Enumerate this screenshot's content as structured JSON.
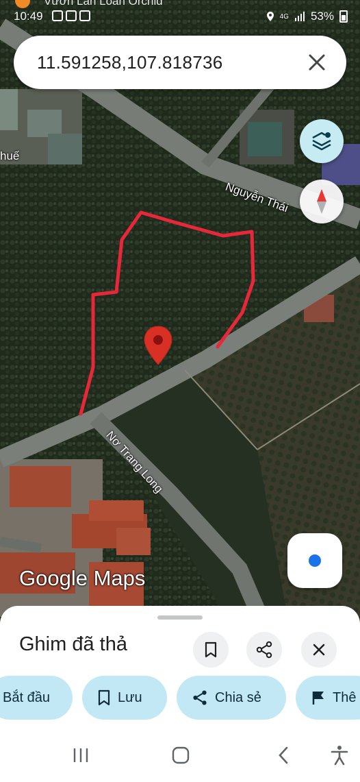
{
  "status_bar": {
    "time": "10:49",
    "notification_title": "Vườn Lan Loan Orchid",
    "signal_label": "4G",
    "battery_percent": "53%"
  },
  "search": {
    "query": "11.591258,107.818736"
  },
  "map": {
    "labels": {
      "road_nguyen": "Nguyễn Thái",
      "area_hue": "huế",
      "road_notrang": "Nơ Trang Long"
    },
    "logo": "Google Maps",
    "pin_color": "#d93025",
    "boundary_color": "#e8283a"
  },
  "sheet": {
    "title": "Ghim đã thả",
    "chips": {
      "start": "Bắt đầu",
      "save": "Lưu",
      "share": "Chia sẻ",
      "flag": "Thê"
    }
  },
  "icons": {
    "close": "close-icon",
    "layers": "layers-icon",
    "compass": "compass-icon",
    "locate": "my-location-icon",
    "bookmark": "bookmark-icon",
    "share": "share-icon",
    "flag": "flag-icon",
    "recents": "recents-icon",
    "home": "home-icon",
    "back": "back-icon",
    "accessibility": "accessibility-icon"
  }
}
